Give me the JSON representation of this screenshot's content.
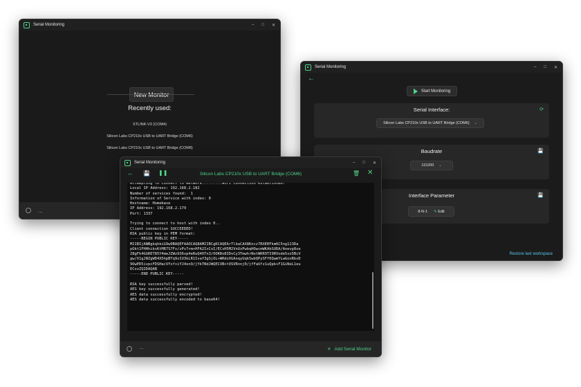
{
  "windows": {
    "launcher": {
      "title": "Serial Monitoring",
      "new_monitor_label": "New Monitor",
      "recent_title": "Recently used:",
      "recent_items": [
        "STLINK-V3 (COM4)",
        "Silicon Labs CP210x USB to UART Bridge (COM6)",
        "Silicon Labs CP210x USB to UART Bridge (COM8)"
      ],
      "more_label": "..."
    },
    "config": {
      "title": "Serial Monitoring",
      "start_label": "Start Monitoring",
      "serial_interface": {
        "title": "Serial Interface:",
        "selected": "Silicon Labs CP210x USB to UART Bridge (COM6)"
      },
      "baudrate": {
        "title": "Baudrate",
        "selected": "115200"
      },
      "interface_parameter": {
        "title": "Interface Parameter",
        "value": "8-N-1",
        "edit_label": "Edit"
      },
      "restore_label": "Restore last workspace"
    },
    "monitor": {
      "title": "Serial Monitoring",
      "device": "Silicon Labs CP210x USB to UART Bridge (COM6)",
      "lines": [
        "Attempting to connect to Network.........WiFi connection established!",
        "Local IP Address: 192.168.2.182",
        "Number of services found:  1",
        "Information of Service with index: 0",
        "Hostname: Homebase",
        "IP Address: 192.168.2.179",
        "Port: 1337",
        "",
        "Trying to connect to host with index 0..",
        "Client connection SUCCEEDED!",
        "RSA public key in PEM format:",
        "-----BEGIN PUBLIC KEY-----",
        "MIIBIjANBgkqhkiG9w0BAQEFAAOCAQ8AMIIBCgKCAQEArTlbaCAX8Kncz7RXERFkm6C5ng123Da",
        "pOkt1FHHhiksKtMR7S7Fx/zPv7+m+HFA2IxCoI/ECsH5M2VnUzPwbqHOwcmWKAbSUDA/Anevp8se",
        "Z8gFk4GGRET85Y4meJZWz936vp4eRuQ4OTn3/OOKRo8IDvCy3TmwhrNotWKR9TI9RVode5so5BcV",
        "gw/X1gJNZgWD4X5hpBTq9xIU3kLR1Ivaf3gSjOL+WRdoXGAnqyUqk5wbQPySFf6QwmYLwGooRbvD",
        "9OwPD5ivpcFDSHacVYxf+iYJ4on9/jYkTNdJWQECXB+tOSVRnnj0/jfFaUfz1uQpk+F1GiNeL1eu",
        "ECsxZQIDAQAB",
        "-----END PUBLIC KEY-----",
        "",
        "RSA key successfully parsed!",
        "AES key successfully generated!",
        "AES data successfully encrypted!",
        "AES data successfully encoded to base64!"
      ],
      "add_label": "Add Serial Monitor"
    }
  },
  "colors": {
    "accent": "#4fd38a",
    "link": "#58c7ee"
  }
}
